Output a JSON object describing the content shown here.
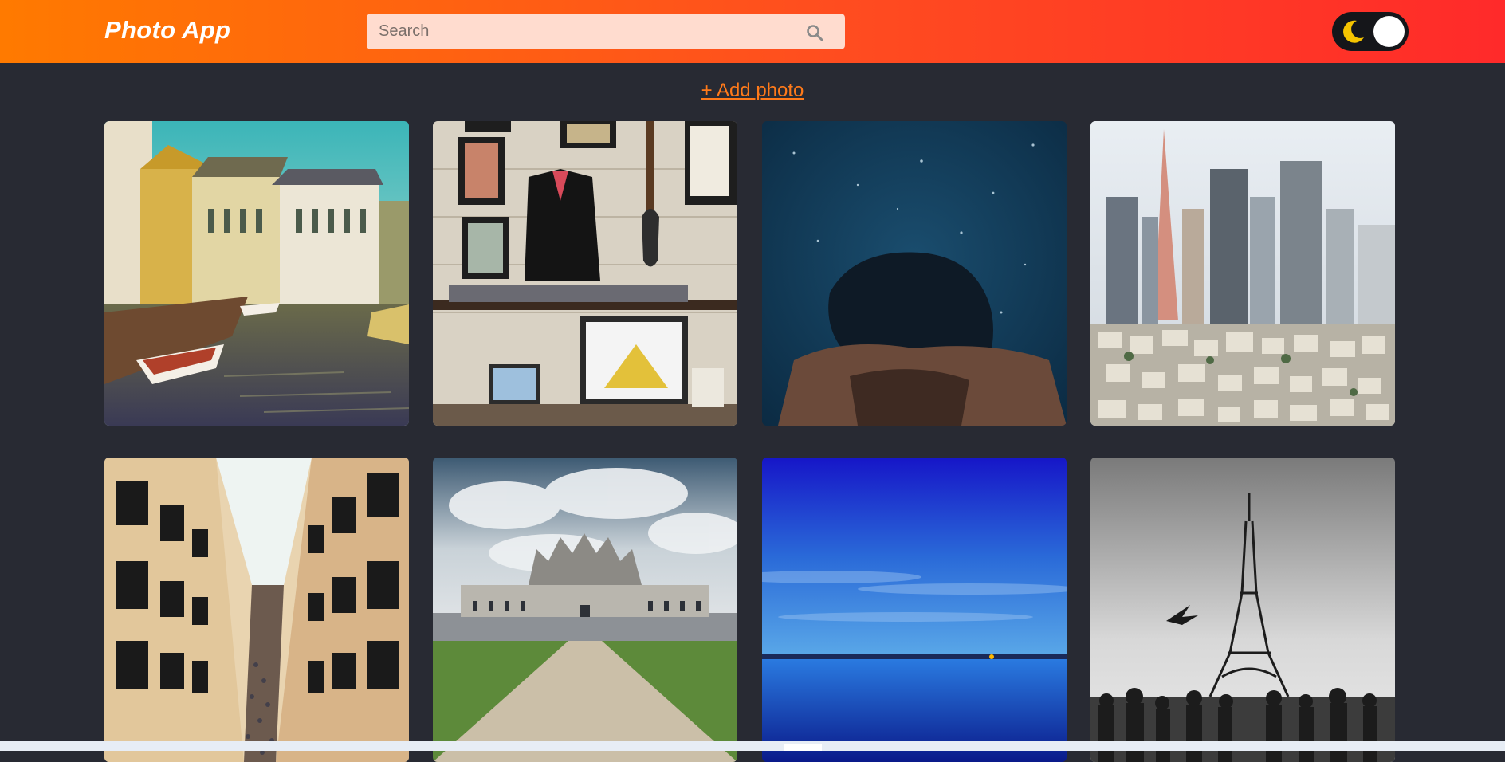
{
  "header": {
    "brand": "Photo App",
    "search_placeholder": "Search"
  },
  "actions": {
    "add_photo": "+ Add photo"
  },
  "theme_toggle": {
    "state": "dark"
  },
  "icons": [
    "search-icon",
    "moon-icon"
  ],
  "colors": {
    "header_gradient_start": "#ff7a00",
    "header_gradient_end": "#ff2a2a",
    "page_background": "#282a33",
    "accent_link": "#ff7a1a",
    "search_background": "#ffdccf",
    "toggle_background": "#15161a",
    "moon": "#f5c400"
  }
}
